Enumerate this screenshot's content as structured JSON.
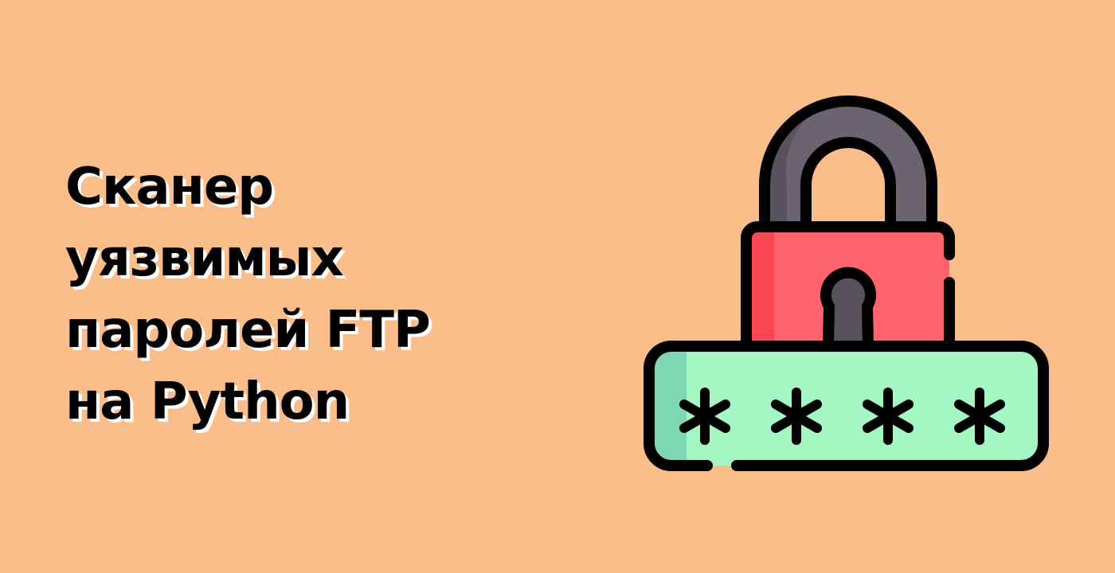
{
  "title": {
    "lines": [
      "Сканер",
      "уязвимых",
      "паролей FTP",
      "на Python"
    ]
  },
  "illustration": {
    "icon": "padlock-password-icon",
    "mask_char": "*",
    "mask_count": 4
  },
  "colors": {
    "background": "#FBBE8A",
    "lock_body": "#FF646F",
    "lock_body_shade": "#FA4655",
    "shackle": "#6B6470",
    "shackle_shade": "#57525C",
    "password_field": "#A4F6C3",
    "password_field_shade": "#7FD6B4",
    "outline": "#000000"
  }
}
